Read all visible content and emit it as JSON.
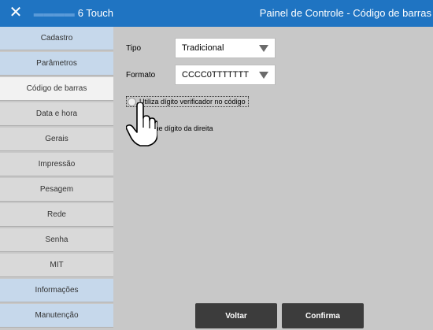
{
  "titlebar": {
    "close_glyph": "✕",
    "app_name": "6 Touch",
    "window_title": "Painel de Controle - Código de barras"
  },
  "sidebar": {
    "items": [
      {
        "label": "Cadastro",
        "style": "blue"
      },
      {
        "label": "Parâmetros",
        "style": "blue"
      },
      {
        "label": "Código de barras",
        "style": "active"
      },
      {
        "label": "Data e hora",
        "style": "gray"
      },
      {
        "label": "Gerais",
        "style": "gray"
      },
      {
        "label": "Impressão",
        "style": "gray"
      },
      {
        "label": "Pesagem",
        "style": "gray"
      },
      {
        "label": "Rede",
        "style": "gray"
      },
      {
        "label": "Senha",
        "style": "gray"
      },
      {
        "label": "MIT",
        "style": "gray"
      },
      {
        "label": "Informações",
        "style": "blue"
      },
      {
        "label": "Manutenção",
        "style": "blue"
      }
    ]
  },
  "form": {
    "tipo_label": "Tipo",
    "tipo_value": "Tradicional",
    "formato_label": "Formato",
    "formato_value": "CCCC0TTTTTTT",
    "verifier_checkbox_label": "Utiliza dígito verificador no código",
    "hint_text": "me dígito da direita"
  },
  "buttons": {
    "back_label": "Voltar",
    "confirm_label": "Confirma"
  },
  "colors": {
    "titlebar": "#1f74c2",
    "sidebar_blue": "#c6d8eb",
    "sidebar_gray": "#d9d9d9",
    "sidebar_active": "#f2f2f2",
    "button_dark": "#3c3c3c"
  }
}
